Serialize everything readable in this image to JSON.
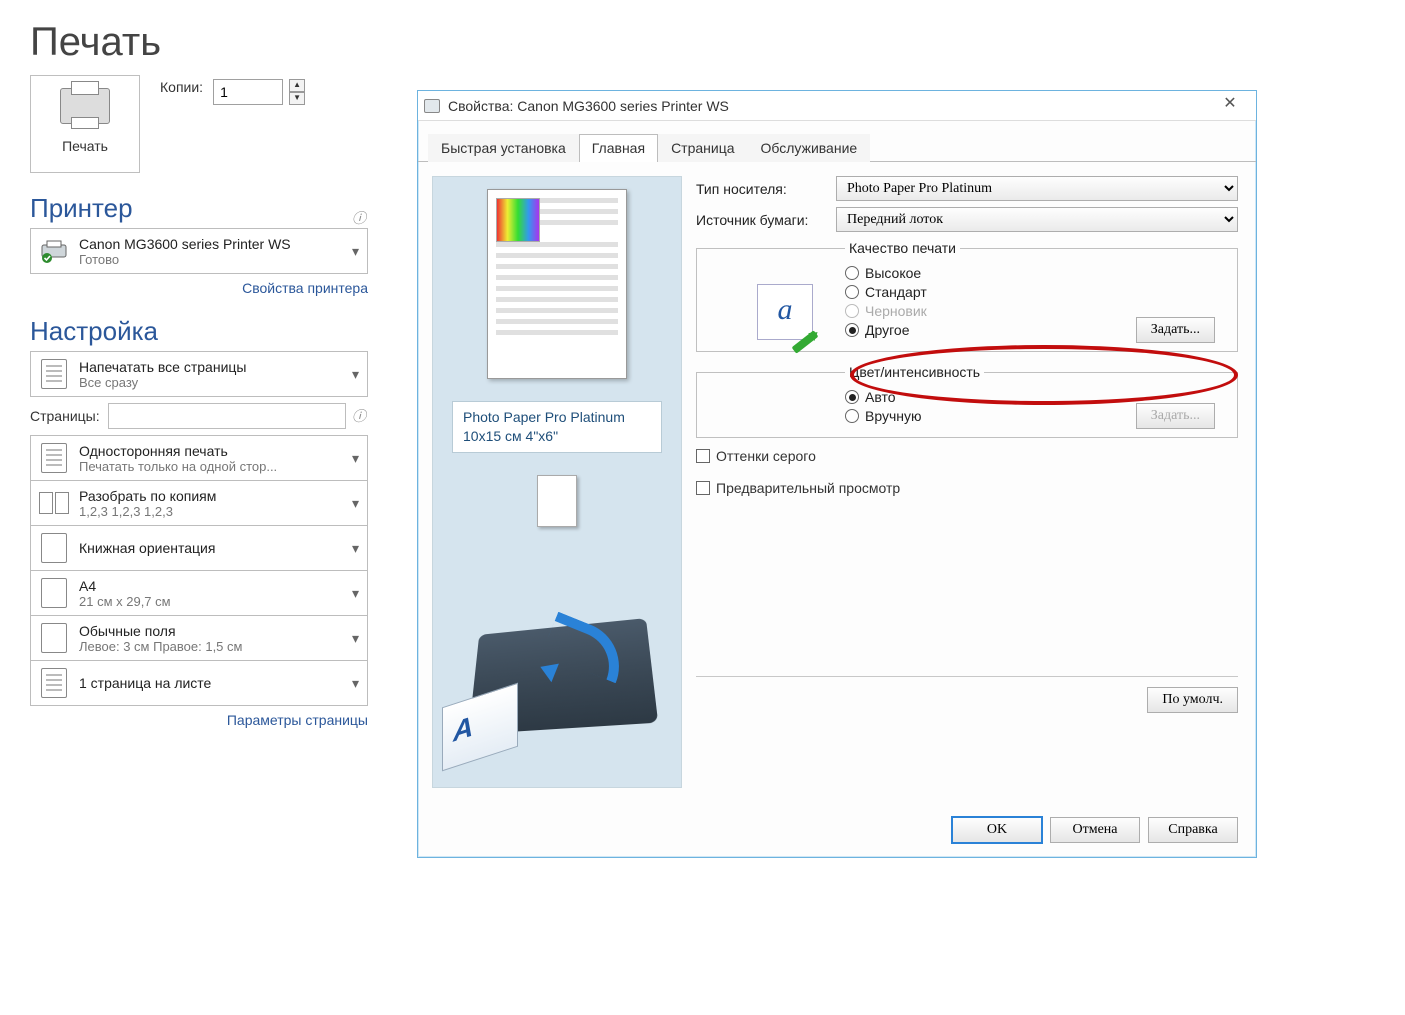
{
  "left": {
    "title": "Печать",
    "print_button": "Печать",
    "copies_label": "Копии:",
    "copies_value": "1",
    "printer_section": "Принтер",
    "printer_name": "Canon MG3600 series Printer WS",
    "printer_status": "Готово",
    "printer_properties_link": "Свойства принтера",
    "settings_section": "Настройка",
    "range_title": "Напечатать все страницы",
    "range_sub": "Все сразу",
    "pages_label": "Страницы:",
    "duplex_title": "Односторонняя печать",
    "duplex_sub": "Печатать только на одной стор...",
    "collate_title": "Разобрать по копиям",
    "collate_sub": "1,2,3    1,2,3    1,2,3",
    "orient_title": "Книжная ориентация",
    "size_title": "A4",
    "size_sub": "21 см x 29,7 см",
    "margins_title": "Обычные поля",
    "margins_sub": "Левое:  3 см    Правое:  1,5 см",
    "per_sheet": "1 страница на листе",
    "page_setup_link": "Параметры страницы"
  },
  "dialog": {
    "title": "Свойства: Canon MG3600 series Printer WS",
    "tabs": [
      "Быстрая установка",
      "Главная",
      "Страница",
      "Обслуживание"
    ],
    "active_tab": 1,
    "preview_paper_name": "Photo Paper Pro Platinum",
    "preview_paper_size": "10x15 см 4\"x6\"",
    "media_label": "Тип носителя:",
    "media_value": "Photo Paper Pro Platinum",
    "source_label": "Источник бумаги:",
    "source_value": "Передний лоток",
    "quality_legend": "Качество печати",
    "quality_options": {
      "high": "Высокое",
      "standard": "Стандарт",
      "draft": "Черновик",
      "other": "Другое"
    },
    "quality_selected": "other",
    "quality_set_btn": "Задать...",
    "color_legend": "Цвет/интенсивность",
    "color_options": {
      "auto": "Авто",
      "manual": "Вручную"
    },
    "color_selected": "auto",
    "color_set_btn": "Задать...",
    "grayscale": "Оттенки серого",
    "preview_before": "Предварительный просмотр",
    "defaults_btn": "По умолч.",
    "ok_btn": "OK",
    "cancel_btn": "Отмена",
    "help_btn": "Справка"
  }
}
